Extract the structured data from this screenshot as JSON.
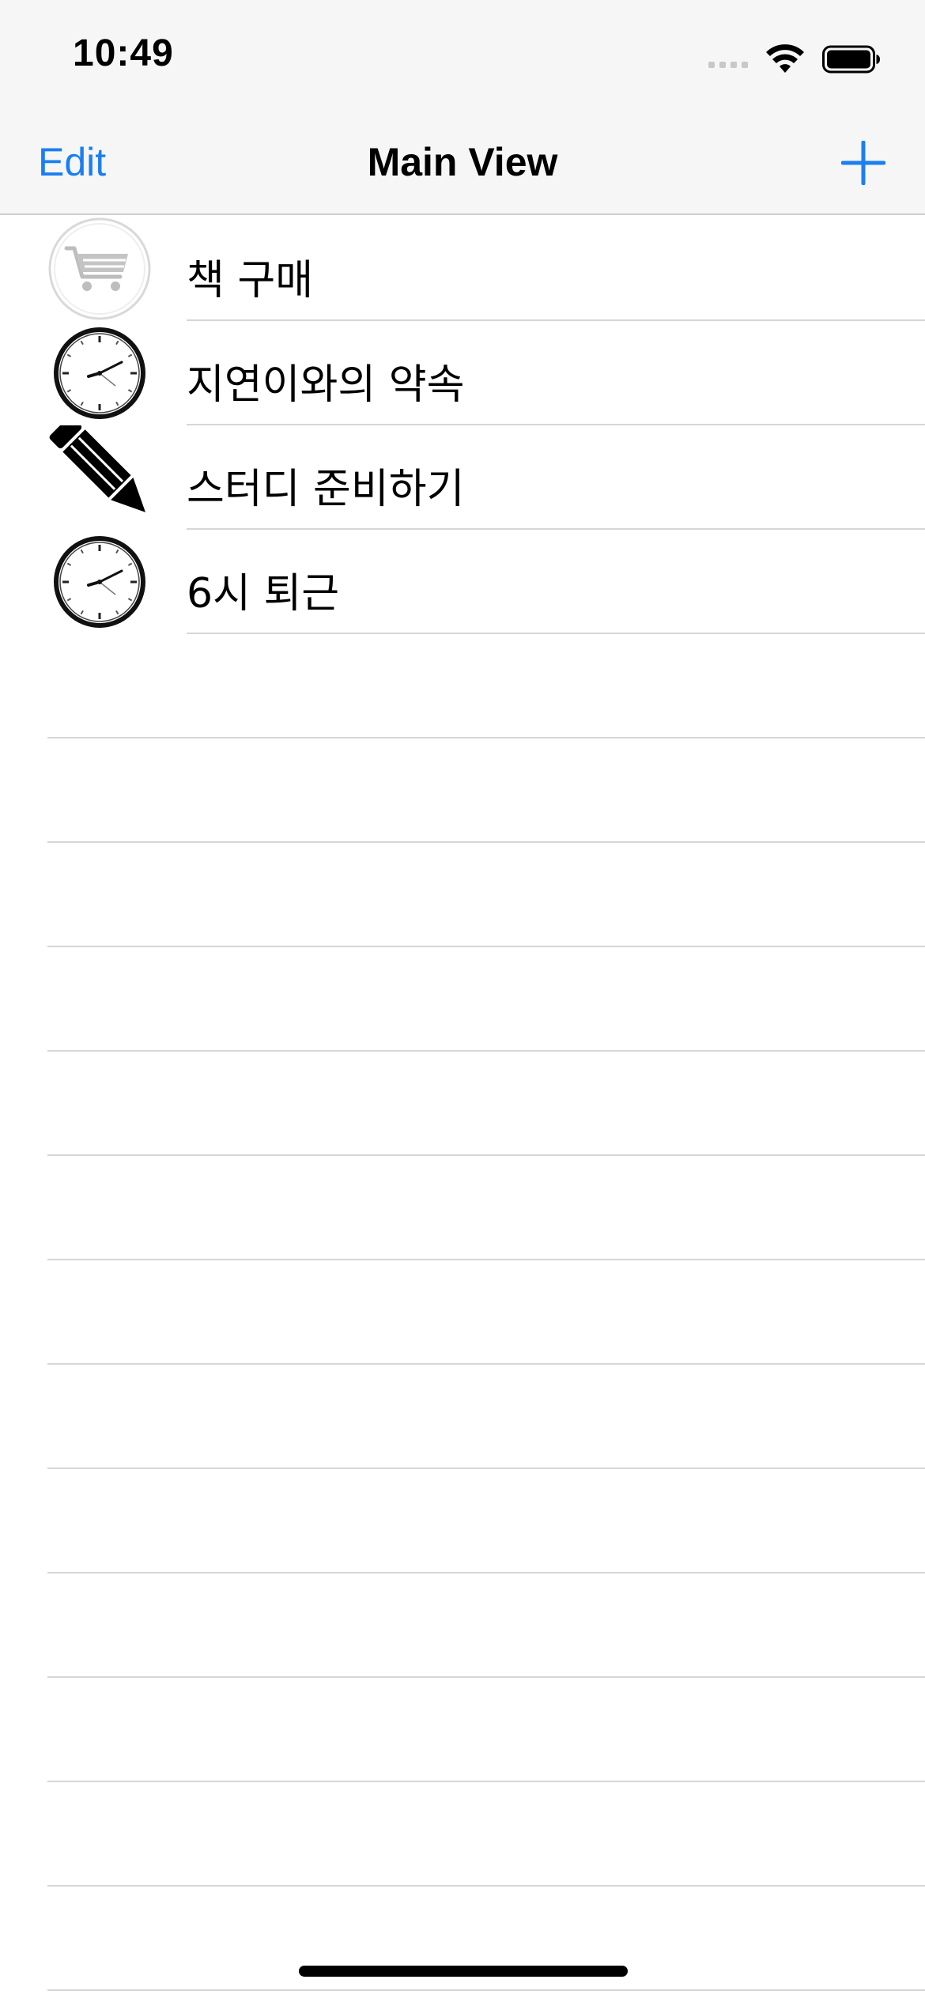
{
  "status_bar": {
    "time": "10:49"
  },
  "nav_bar": {
    "title": "Main View",
    "edit_label": "Edit",
    "add_icon": "plus-icon",
    "accent_color": "#1a7ff0"
  },
  "items": [
    {
      "label": "책 구매",
      "icon": "cart-icon"
    },
    {
      "label": "지연이와의 약속",
      "icon": "clock-icon"
    },
    {
      "label": "스터디 준비하기",
      "icon": "pencil-icon"
    },
    {
      "label": "6시 퇴근",
      "icon": "clock-icon"
    }
  ]
}
